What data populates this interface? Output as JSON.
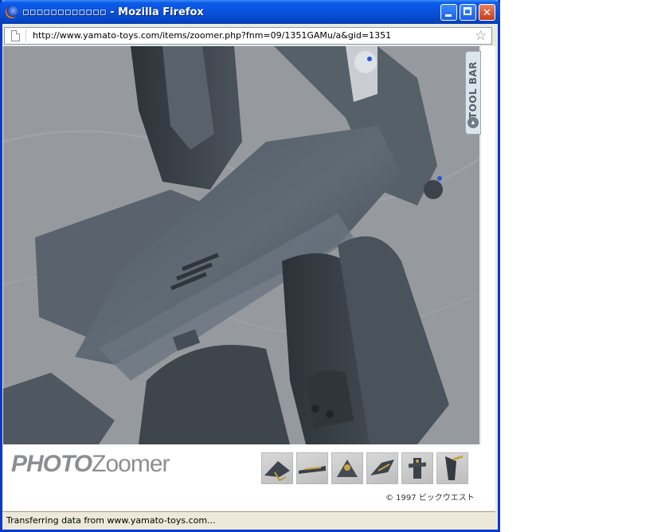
{
  "window": {
    "title": "▫▫▫▫▫▫▫▫▫▫▫▫ - Mozilla Firefox"
  },
  "address_bar": {
    "url": "http://www.yamato-toys.com/items/zoomer.php?fnm=09/1351GAMu/a&gid=1351"
  },
  "viewer": {
    "toolbar_label": "TOOL BAR",
    "logo": {
      "photo": "PHOTO",
      "zoomer": "Zoomer"
    },
    "thumbnails": [
      "thumbnail-1",
      "thumbnail-2",
      "thumbnail-3",
      "thumbnail-4",
      "thumbnail-5",
      "thumbnail-6"
    ],
    "copyright": "© 1997 ビックウエスト"
  },
  "status_bar": {
    "text": "Transferring data from www.yamato-toys.com..."
  },
  "colors": {
    "titlebar": "#0a52de",
    "window_frame": "#0839d0",
    "chrome": "#ece9d8",
    "close_button": "#c33d1a"
  },
  "icons": [
    "firefox-icon",
    "page-icon",
    "bookmark-star-icon",
    "minimize-icon",
    "maximize-icon",
    "close-icon",
    "toolbar-arrow-icon"
  ]
}
